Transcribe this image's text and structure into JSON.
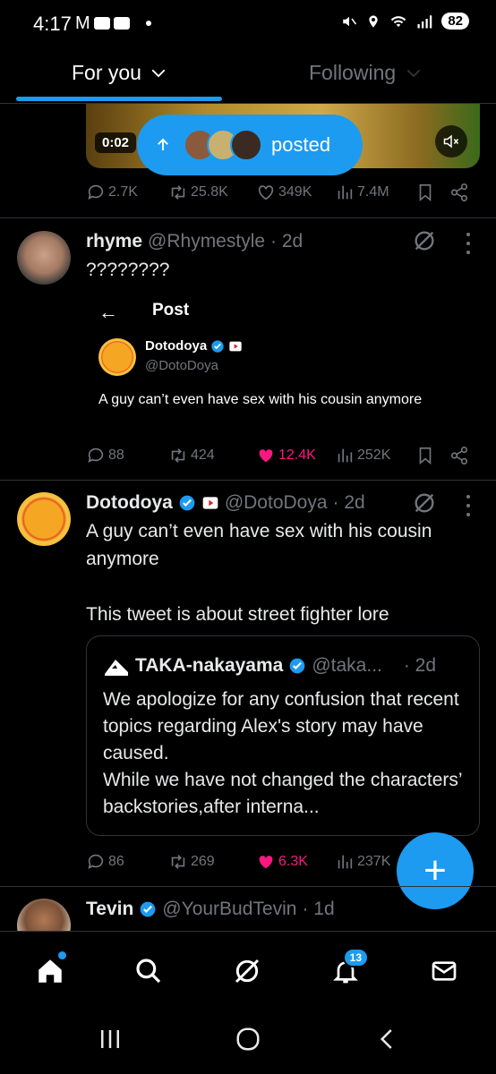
{
  "status_bar": {
    "time": "4:17",
    "left_icons": [
      "gmail-icon",
      "youtube-icon",
      "youtube-icon",
      "dot"
    ],
    "right_icons": [
      "mute-icon",
      "location-icon",
      "wifi-icon",
      "signal-icon"
    ],
    "battery": "82"
  },
  "tabs": {
    "for_you": "For you",
    "following": "Following"
  },
  "top_post": {
    "video_time": "0:02",
    "posted_label": "posted",
    "actions": {
      "replies": "2.7K",
      "reposts": "25.8K",
      "likes": "349K",
      "views": "7.4M"
    }
  },
  "tweets": [
    {
      "name": "rhyme",
      "handle": "@Rhymestyle",
      "time": "· 2d",
      "text": "????????",
      "embedded": {
        "back": "←",
        "title": "Post",
        "author_name": "Dotodoya",
        "author_handle": "@DotoDoya",
        "text": "A guy can’t even have sex with his cousin anymore"
      },
      "actions": {
        "replies": "88",
        "reposts": "424",
        "likes": "12.4K",
        "views": "252K"
      }
    },
    {
      "name": "Dotodoya",
      "handle": "@DotoDoya",
      "time": "· 2d",
      "text": "A guy can’t even have sex with his cousin anymore\n\nThis tweet is about street fighter lore",
      "quote": {
        "name": "TAKA-nakayama",
        "handle": "@taka...",
        "time": "· 2d",
        "text": "We apologize for any confusion that recent topics regarding Alex's story may have caused.\nWhile we have not changed the characters’ backstories,after interna..."
      },
      "actions": {
        "replies": "86",
        "reposts": "269",
        "likes": "6.3K",
        "views": "237K"
      }
    },
    {
      "name": "Tevin",
      "handle": "@YourBudTevin",
      "time": "· 1d"
    }
  ],
  "bottom_nav": {
    "notifications_badge": "13"
  },
  "colors": {
    "accent": "#1d9bf0",
    "like": "#f91880",
    "muted": "#71767b",
    "background": "#000000"
  }
}
